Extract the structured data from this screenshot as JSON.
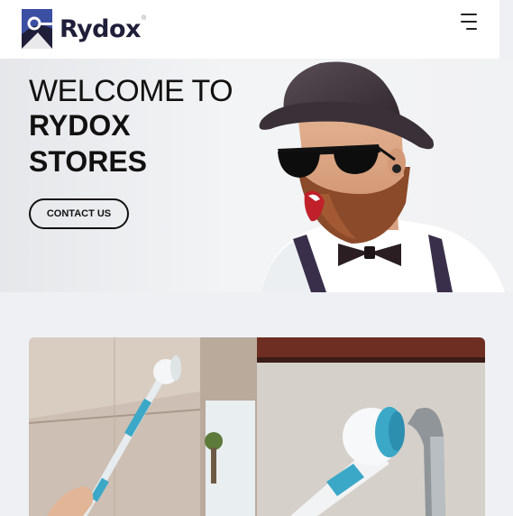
{
  "header": {
    "brand_name": "Rydox",
    "registered_mark": "®",
    "menu_icon": "hamburger-menu-icon"
  },
  "hero": {
    "heading_line1": "WELCOME TO",
    "heading_line2": "RYDOX",
    "heading_line3": "STORES",
    "contact_button_label": "CONTACT US"
  },
  "colors": {
    "page_background": "#eef0f4",
    "text_dark": "#111111",
    "logo_blue": "#3b4fa3",
    "logo_navy": "#1f1f3a",
    "product_accent": "#3ba8c8"
  }
}
